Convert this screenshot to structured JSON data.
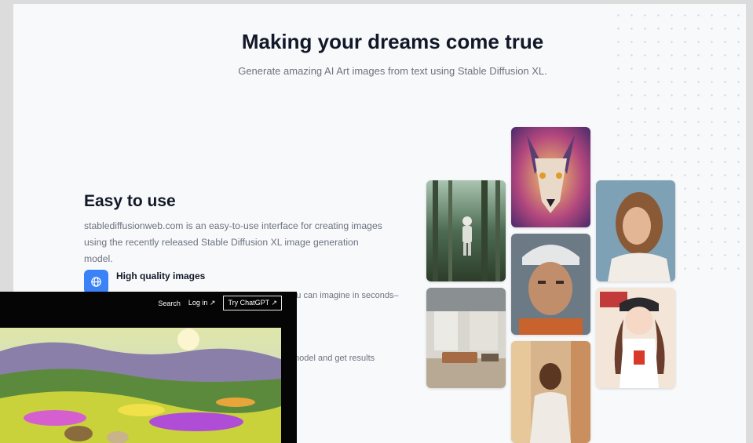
{
  "hero": {
    "title": "Making your dreams come true",
    "subtitle": "Generate amazing AI Art images from text using Stable Diffusion XL."
  },
  "feature": {
    "title": "Easy to use",
    "description": "stablediffusionweb.com is an easy-to-use interface for creating images using the recently released Stable Diffusion XL image generation model.",
    "item_title": "High quality images",
    "item_description_partial": "It can create high quality images of anything you can imagine in seconds–",
    "item_description_partial_2": "model and get results"
  },
  "overlay": {
    "search_label": "Search",
    "login_label": "Log in ↗",
    "chatgpt_label": "Try ChatGPT ↗"
  },
  "icons": {
    "feature_icon": "globe-icon"
  },
  "colors": {
    "accent": "#3b82f6",
    "title": "#111827",
    "muted": "#6b7280"
  }
}
